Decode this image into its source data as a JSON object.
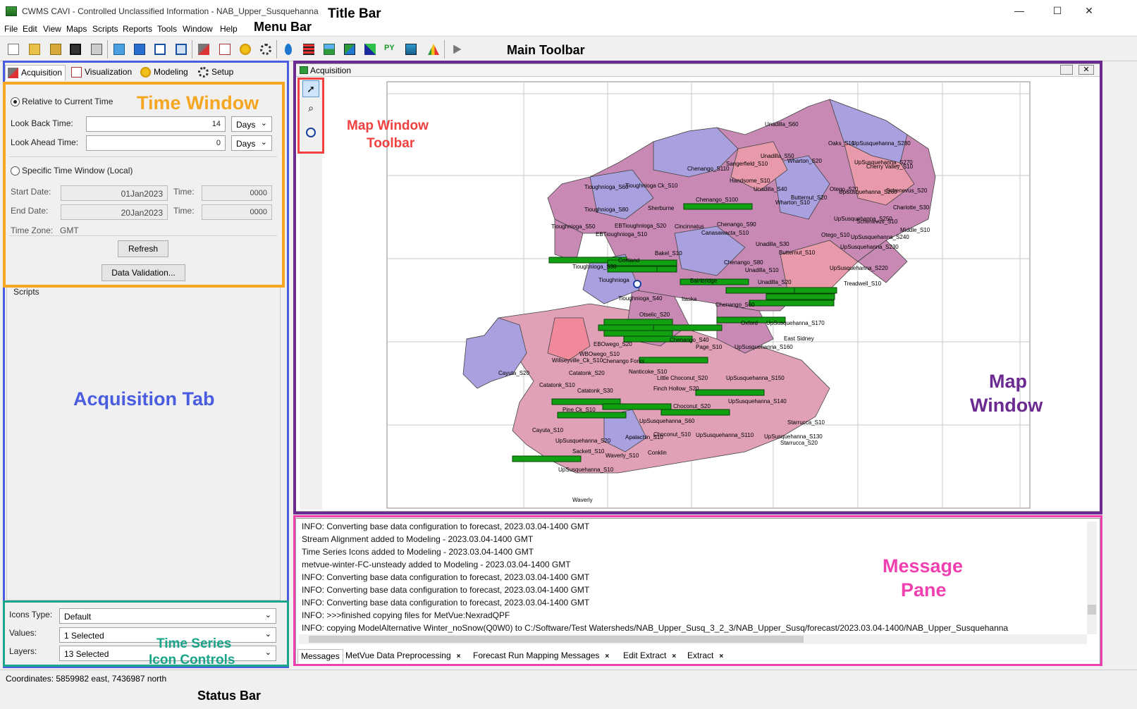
{
  "window": {
    "title": "CWMS CAVI - Controlled Unclassified Information - NAB_Upper_Susquehanna",
    "minimize": "—",
    "maximize": "☐",
    "close": "✕"
  },
  "menu": [
    "File",
    "Edit",
    "View",
    "Maps",
    "Scripts",
    "Reports",
    "Tools",
    "Window",
    "Help"
  ],
  "annotations": {
    "title_bar": "Title Bar",
    "menu_bar": "Menu Bar",
    "main_toolbar": "Main Toolbar",
    "time_window": "Time Window",
    "acquisition_tab": "Acquisition Tab",
    "ts_icon_controls_1": "Time Series",
    "ts_icon_controls_2": "Icon Controls",
    "status_bar": "Status Bar",
    "map_window_toolbar_1": "Map Window",
    "map_window_toolbar_2": "Toolbar",
    "map_window_1": "Map",
    "map_window_2": "Window",
    "message_pane_1": "Message",
    "message_pane_2": "Pane",
    "colors": {
      "title": "#000000",
      "time_window": "#f5a623",
      "acquisition": "#4a5ce0",
      "icon_controls": "#1aa58a",
      "map_toolbar": "#f04040",
      "map_window": "#6a2a90",
      "message": "#f040b0"
    }
  },
  "toolbar": {
    "icons": [
      "new-icon",
      "open-icon",
      "open-folder-icon",
      "save-icon",
      "print-icon",
      "sync-icon",
      "refresh-icon",
      "layout-icon",
      "cascade-icon",
      "acquisition-icon",
      "visualization-icon",
      "modeling-icon",
      "setup-icon",
      "water-drop-icon",
      "grid-icon",
      "landscape-icon",
      "map-icon",
      "raster-icon",
      "python-icon",
      "display-icon",
      "chart-icon",
      "run-icon"
    ],
    "python_label": "PY"
  },
  "tabs": [
    {
      "label": "Acquisition",
      "icon": "acquisition-icon"
    },
    {
      "label": "Visualization",
      "icon": "visualization-icon"
    },
    {
      "label": "Modeling",
      "icon": "modeling-icon"
    },
    {
      "label": "Setup",
      "icon": "gear-icon"
    }
  ],
  "time_window": {
    "relative_label": "Relative to Current Time",
    "look_back_label": "Look Back Time:",
    "look_back_value": "14",
    "look_back_unit": "Days",
    "look_ahead_label": "Look Ahead Time:",
    "look_ahead_value": "0",
    "look_ahead_unit": "Days",
    "specific_label": "Specific Time Window (Local)",
    "start_date_label": "Start Date:",
    "start_date": "01Jan2023",
    "start_time_label": "Time:",
    "start_time": "0000",
    "end_date_label": "End Date:",
    "end_date": "20Jan2023",
    "end_time_label": "Time:",
    "end_time": "0000",
    "timezone_label": "Time Zone:",
    "timezone": "GMT",
    "refresh": "Refresh",
    "validation": "Data Validation..."
  },
  "scripts_label": "Scripts",
  "icon_controls": {
    "icons_type_label": "Icons Type:",
    "icons_type": "Default",
    "values_label": "Values:",
    "values": "1 Selected",
    "layers_label": "Layers:",
    "layers": "13 Selected"
  },
  "map": {
    "window_title": "Acquisition",
    "labels": [
      "Unadilla_S60",
      "UpSusquehanna_S280",
      "Oaks_S10",
      "Unadilla_S50",
      "Wharton_S20",
      "UpSusquehanna_S270",
      "Cherry Valley_S10",
      "Chenango_S110",
      "Sangerfield_S10",
      "Handsome_S10",
      "Unadilla_S40",
      "Otego_S20",
      "UpSusquehanna_S260",
      "Schenevus_S20",
      "Tioughnioga_S60",
      "Tioughnioga Ck_S10",
      "Sherburne",
      "Chenango_S100",
      "Butternut_S20",
      "Wharton_S10",
      "Charlotte_S30",
      "Tioughnioga_S80",
      "EBTioughnioga_S20",
      "Cincinnatus",
      "Chenango_S90",
      "UpSusquehanna_S250",
      "Schenevus_S10",
      "Middle_S10",
      "Tioughnioga_S50",
      "EBTioughnioga_S10",
      "Canasawacta_S10",
      "Unadilla_S30",
      "Otego_S10",
      "UpSusquehanna_S240",
      "Cortland",
      "Tioughnioga_S30",
      "Bakel_S10",
      "Chenango_S80",
      "Butternut_S10",
      "Unadilla_S10",
      "UpSusquehanna_S230",
      "Tioughnioga",
      "Tioughnioga_S40",
      "Bainbridge",
      "Itaska",
      "Unadilla_S20",
      "UpSusquehanna_S220",
      "Treadwell_S10",
      "Otselic_S20",
      "Chenango_S60",
      "Oxford",
      "UpSusquehanna_S170",
      "East Sidney",
      "EBOwego_S20",
      "Chenango_S40",
      "Page_S10",
      "UpSusquehanna_S160",
      "Cayuta_S20",
      "WBOwego_S10",
      "Willseyville_Ck_S10",
      "Chenango Forks",
      "Catatonk_S20",
      "Nanticoke_S10",
      "Little Choconut_S20",
      "UpSusquehanna_S150",
      "Catatonk_S10",
      "Finch Hollow_S20",
      "UpSusquehanna_S140",
      "Catatonk_S30",
      "Choconut_S20",
      "Pine Ck_S10",
      "UpSusquehanna_S60",
      "Starrucca_S10",
      "Cayuta_S10",
      "UpSusquehanna_S20",
      "Choconut_S10",
      "UpSusquehanna_S110",
      "UpSusquehanna_S130",
      "Starrucca_S20",
      "Sackett_S10",
      "Apalachin_S10",
      "Waverly_S10",
      "Conklin",
      "UpSusquehanna_S10",
      "Waverly"
    ]
  },
  "messages": {
    "lines": [
      "INFO: Converting base data configuration to forecast, 2023.03.04-1400 GMT",
      "Stream Alignment added to Modeling - 2023.03.04-1400 GMT",
      "Time Series Icons added to Modeling - 2023.03.04-1400 GMT",
      "metvue-winter-FC-unsteady added to Modeling - 2023.03.04-1400 GMT",
      "INFO: Converting base data configuration to forecast, 2023.03.04-1400 GMT",
      "INFO: Converting base data configuration to forecast, 2023.03.04-1400 GMT",
      "INFO: Converting base data configuration to forecast, 2023.03.04-1400 GMT",
      "INFO: >>>finished copying files for MetVue:NexradQPF",
      "INFO: copying ModelAlternative Winter_noSnow(Q0W0) to C:/Software/Test Watersheds/NAB_Upper_Susq_3_2_3/NAB_Upper_Susq/forecast/2023.03.04-1400/NAB_Upper_Susquehanna"
    ],
    "tabs": [
      "Messages",
      "MetVue Data Preprocessing",
      "Forecast Run Mapping Messages",
      "Edit Extract",
      "Extract"
    ]
  },
  "status": {
    "coordinates": "Coordinates: 5859982 east, 7436987 north"
  }
}
